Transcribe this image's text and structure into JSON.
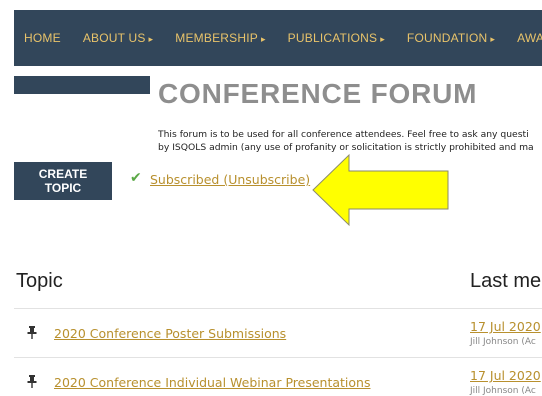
{
  "nav": {
    "items": [
      {
        "label": "HOME",
        "has_arrow": false
      },
      {
        "label": "ABOUT US",
        "has_arrow": true
      },
      {
        "label": "MEMBERSHIP",
        "has_arrow": true
      },
      {
        "label": "PUBLICATIONS",
        "has_arrow": true
      },
      {
        "label": "FOUNDATION",
        "has_arrow": true
      },
      {
        "label": "AWARDS",
        "has_arrow": true
      }
    ],
    "arrow_glyph": "▸"
  },
  "page": {
    "title": "CONFERENCE FORUM",
    "intro_line1": "This forum is to be used for all conference attendees. Feel free to ask any questi",
    "intro_line2": "by ISQOLS admin (any use of profanity or solicitation is strictly prohibited and ma"
  },
  "actions": {
    "create_topic_label": "CREATE TOPIC",
    "subscribed_label": "Subscribed (Unsubscribe)"
  },
  "table": {
    "topic_header": "Topic",
    "last_header": "Last me",
    "rows": [
      {
        "title": "2020 Conference Poster Submissions",
        "date": "17 Jul 2020",
        "author": "Jill Johnson (Ac"
      },
      {
        "title": "2020 Conference Individual Webinar Presentations",
        "date": "17 Jul 2020",
        "author": "Jill Johnson (Ac"
      }
    ]
  },
  "colors": {
    "nav_bg": "#32465a",
    "nav_text": "#e8c36a",
    "link": "#b8902e",
    "title_gray": "#8e8e8e",
    "annotation_arrow": "#ffff00",
    "check_green": "#5aa845"
  },
  "icons": {
    "check": "check-icon",
    "pin": "pin-icon",
    "annotation": "arrow-left-icon"
  }
}
